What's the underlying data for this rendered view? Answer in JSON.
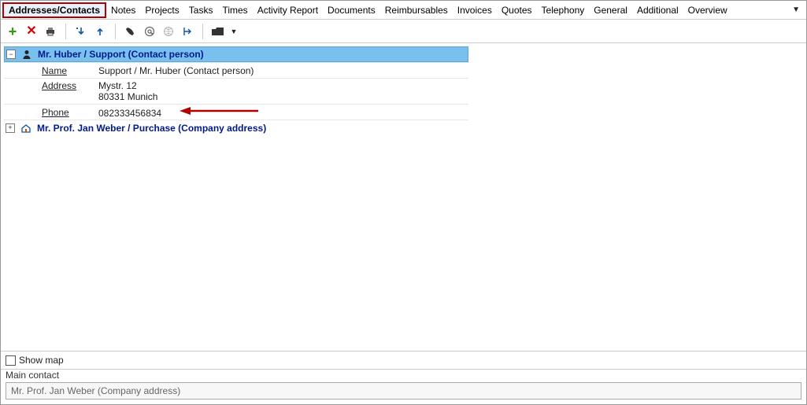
{
  "tabs": {
    "items": [
      "Addresses/Contacts",
      "Notes",
      "Projects",
      "Tasks",
      "Times",
      "Activity Report",
      "Documents",
      "Reimbursables",
      "Invoices",
      "Quotes",
      "Telephony",
      "General",
      "Additional",
      "Overview"
    ],
    "active_index": 0
  },
  "contacts": [
    {
      "expanded": true,
      "icon": "person",
      "title": "Mr. Huber / Support (Contact person)",
      "fields": {
        "name_label": "Name",
        "name_value": "Support / Mr. Huber (Contact person)",
        "address_label": "Address",
        "address_line1": "Mystr. 12",
        "address_line2": "80331 Munich",
        "phone_label": "Phone",
        "phone_value": "082333456834"
      }
    },
    {
      "expanded": false,
      "icon": "house",
      "title": "Mr. Prof. Jan Weber / Purchase (Company address)"
    }
  ],
  "showmap_label": "Show map",
  "showmap_checked": false,
  "main_contact": {
    "label": "Main contact",
    "value": "Mr. Prof. Jan Weber (Company address)"
  },
  "annotation_arrow_color": "#b00000"
}
